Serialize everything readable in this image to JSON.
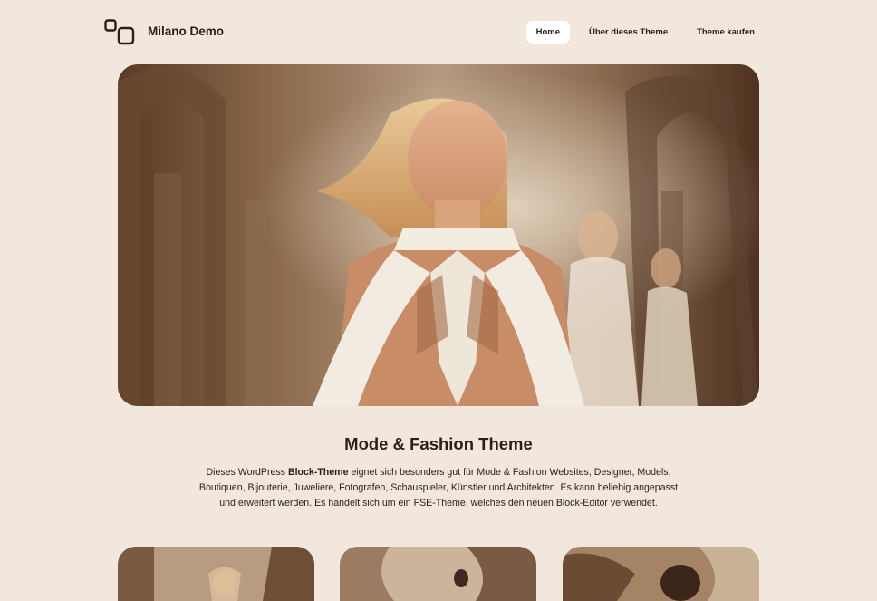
{
  "header": {
    "site_title": "Milano Demo",
    "logo_icon": "two-squares-logo-icon",
    "nav": [
      {
        "label": "Home",
        "active": true
      },
      {
        "label": "Über dieses Theme",
        "active": false
      },
      {
        "label": "Theme kaufen",
        "active": false
      }
    ]
  },
  "hero": {
    "image": "fashion-runway-model-photo"
  },
  "intro": {
    "title": "Mode & Fashion Theme",
    "text_before": "Dieses WordPress ",
    "text_bold": "Block-Theme",
    "text_after": " eignet sich besonders gut für Mode & Fashion Websites, Designer, Models, Boutiquen, Bijouterie, Juweliere, Fotografen, Schauspieler, Künstler und Architekten. Es kann beliebig angepasst und erweitert werden. Es handelt sich um ein FSE-Theme, welches den neuen Block-Editor verwendet."
  },
  "cards": [
    {
      "image": "runway-model-photo"
    },
    {
      "image": "fashion-model-dress-photo"
    },
    {
      "image": "woman-palm-leaves-photo"
    }
  ],
  "colors": {
    "background": "#f1e7dd",
    "text": "#2a1f17",
    "nav_active_bg": "#ffffff"
  }
}
